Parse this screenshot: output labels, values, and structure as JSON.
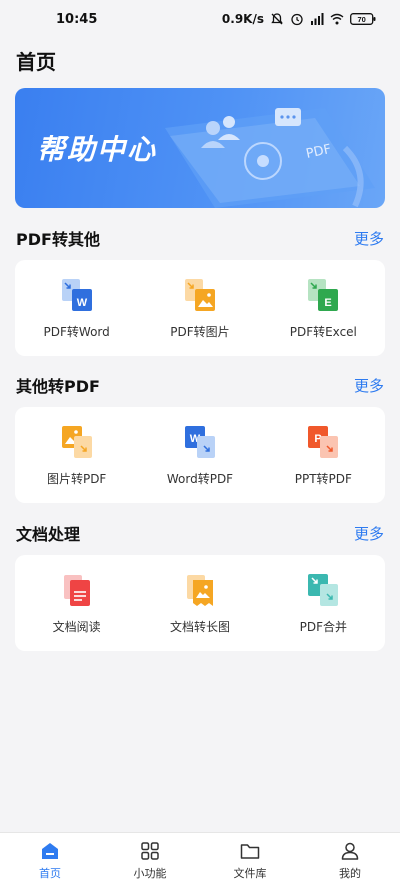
{
  "status_bar": {
    "time": "10:45",
    "net_speed": "0.9K/s",
    "battery": "70"
  },
  "page": {
    "title": "首页"
  },
  "banner": {
    "text": "帮助中心",
    "device_text": "PDF"
  },
  "sections": [
    {
      "title": "PDF转其他",
      "more": "更多",
      "tools": [
        {
          "label": "PDF转Word",
          "icon": "pdf-to-word-icon",
          "color": "#2f6fde"
        },
        {
          "label": "PDF转图片",
          "icon": "pdf-to-image-icon",
          "color": "#f5a623"
        },
        {
          "label": "PDF转Excel",
          "icon": "pdf-to-excel-icon",
          "color": "#2fa84f"
        }
      ]
    },
    {
      "title": "其他转PDF",
      "more": "更多",
      "tools": [
        {
          "label": "图片转PDF",
          "icon": "image-to-pdf-icon",
          "color": "#f5a623"
        },
        {
          "label": "Word转PDF",
          "icon": "word-to-pdf-icon",
          "color": "#2f6fde"
        },
        {
          "label": "PPT转PDF",
          "icon": "ppt-to-pdf-icon",
          "color": "#f0582b"
        }
      ]
    },
    {
      "title": "文档处理",
      "more": "更多",
      "tools": [
        {
          "label": "文档阅读",
          "icon": "document-read-icon",
          "color": "#ef4444"
        },
        {
          "label": "文档转长图",
          "icon": "document-to-long-image-icon",
          "color": "#f5a623"
        },
        {
          "label": "PDF合并",
          "icon": "pdf-merge-icon",
          "color": "#3bb8b0"
        }
      ]
    }
  ],
  "bottom_nav": [
    {
      "label": "首页",
      "icon": "home-icon",
      "active": true
    },
    {
      "label": "小功能",
      "icon": "grid-icon",
      "active": false
    },
    {
      "label": "文件库",
      "icon": "folder-icon",
      "active": false
    },
    {
      "label": "我的",
      "icon": "user-icon",
      "active": false
    }
  ],
  "colors": {
    "accent": "#2e7bf0",
    "background": "#f4f4f6",
    "card": "#ffffff"
  }
}
